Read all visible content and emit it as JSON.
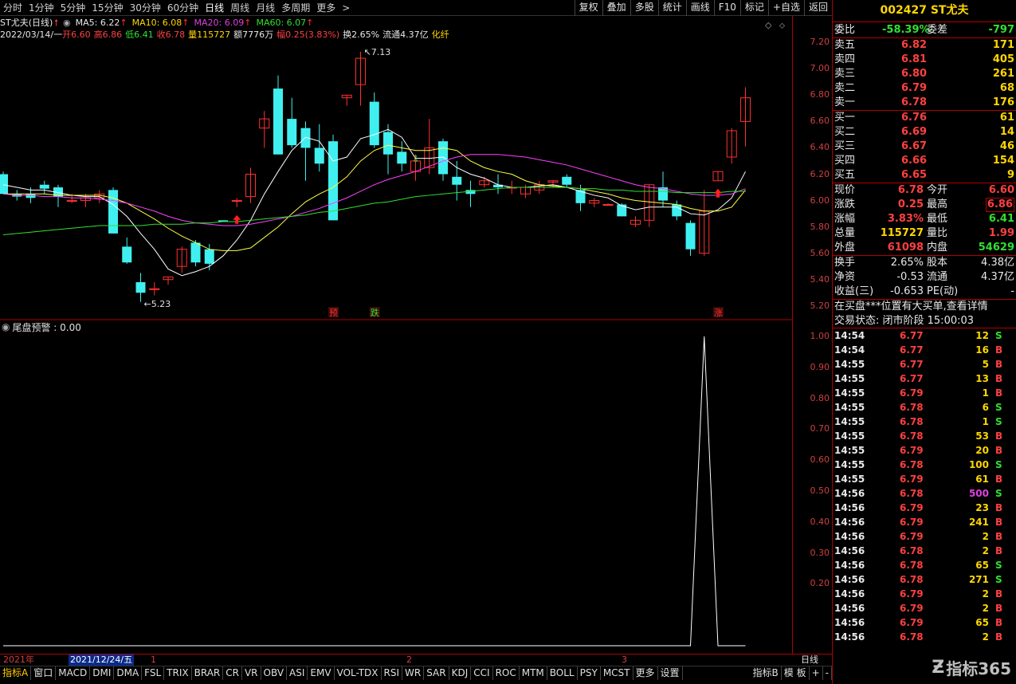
{
  "period_tabs": [
    "分时",
    "1分钟",
    "5分钟",
    "15分钟",
    "30分钟",
    "60分钟",
    "日线",
    "周线",
    "月线",
    "多周期",
    "更多"
  ],
  "active_period": "日线",
  "tool_buttons": [
    "复权",
    "叠加",
    "多股",
    "统计",
    "画线",
    "F10",
    "标记",
    "+自选",
    "返回"
  ],
  "legend": {
    "stock": "ST尤夫(日线)",
    "ma5": "MA5: 6.22",
    "ma10": "MA10: 6.08",
    "ma20": "MA20: 6.09",
    "ma60": "MA60: 6.07"
  },
  "ohlc": {
    "date": "2022/03/14/一",
    "open": "开6.60",
    "high": "高6.86",
    "low": "低6.41",
    "close": "收6.78",
    "vol": "量115727",
    "amount": "额7776万",
    "range": "幅0.25(3.83%)",
    "turnover": "换2.65%",
    "float_cap": "流通4.37亿",
    "sector": "化纤"
  },
  "price_axis": [
    "7.20",
    "7.00",
    "6.80",
    "6.60",
    "6.40",
    "6.20",
    "6.00",
    "5.80",
    "5.60",
    "5.40",
    "5.20"
  ],
  "ind_axis": [
    "1.00",
    "0.90",
    "0.80",
    "0.70",
    "0.60",
    "0.50",
    "0.40",
    "0.30",
    "0.20"
  ],
  "annotations": {
    "high": "7.13",
    "low": "5.23",
    "yu": "预",
    "die": "跌",
    "zhang": "涨"
  },
  "sub_title": "尾盘预警 : 0.00",
  "datebar": {
    "y2021": "2021年",
    "cursor": "2021/12/24/五",
    "m1": "1",
    "m2": "2",
    "m3": "3",
    "right": "日线"
  },
  "indicator_tabs": [
    "指标A",
    "窗口",
    "MACD",
    "DMI",
    "DMA",
    "FSL",
    "TRIX",
    "BRAR",
    "CR",
    "VR",
    "OBV",
    "ASI",
    "EMV",
    "VOL-TDX",
    "RSI",
    "WR",
    "SAR",
    "KDJ",
    "CCI",
    "ROC",
    "MTM",
    "BOLL",
    "PSY",
    "MCST",
    "更多",
    "设置"
  ],
  "indicator_right": [
    "指标B",
    "模 板",
    "+",
    "-"
  ],
  "quote": {
    "title": "002427 ST尤夫",
    "weibi_label": "委比",
    "weibi": "-58.39%",
    "weicha_label": "委差",
    "weicha": "-797",
    "asks": [
      {
        "label": "卖五",
        "price": "6.82",
        "vol": "171"
      },
      {
        "label": "卖四",
        "price": "6.81",
        "vol": "405"
      },
      {
        "label": "卖三",
        "price": "6.80",
        "vol": "261"
      },
      {
        "label": "卖二",
        "price": "6.79",
        "vol": "68"
      },
      {
        "label": "卖一",
        "price": "6.78",
        "vol": "176"
      }
    ],
    "bids": [
      {
        "label": "买一",
        "price": "6.76",
        "vol": "61"
      },
      {
        "label": "买二",
        "price": "6.69",
        "vol": "14"
      },
      {
        "label": "买三",
        "price": "6.67",
        "vol": "46"
      },
      {
        "label": "买四",
        "price": "6.66",
        "vol": "154"
      },
      {
        "label": "买五",
        "price": "6.65",
        "vol": "9"
      }
    ],
    "stats": [
      {
        "l1": "现价",
        "v1": "6.78",
        "l2": "今开",
        "v2": "6.60"
      },
      {
        "l1": "涨跌",
        "v1": "0.25",
        "l2": "最高",
        "v2": "6.86"
      },
      {
        "l1": "涨幅",
        "v1": "3.83%",
        "l2": "最低",
        "v2": "6.41"
      },
      {
        "l1": "总量",
        "v1": "115727",
        "l2": "量比",
        "v2": "1.99"
      },
      {
        "l1": "外盘",
        "v1": "61098",
        "l2": "内盘",
        "v2": "54629"
      }
    ],
    "stats2": [
      {
        "l1": "换手",
        "v1": "2.65%",
        "l2": "股本",
        "v2": "4.38亿"
      },
      {
        "l1": "净资",
        "v1": "-0.53",
        "l2": "流通",
        "v2": "4.37亿"
      },
      {
        "l1": "收益(三)",
        "v1": "-0.653",
        "l2": "PE(动)",
        "v2": "-"
      }
    ],
    "notice": "在买盘***位置有大买单,查看详情",
    "trade_status": "交易状态: 闭市阶段 15:00:03"
  },
  "ticks": [
    {
      "t": "14:54",
      "p": "6.77",
      "v": "12",
      "s": "S"
    },
    {
      "t": "14:54",
      "p": "6.77",
      "v": "16",
      "s": "B"
    },
    {
      "t": "14:55",
      "p": "6.77",
      "v": "5",
      "s": "B"
    },
    {
      "t": "14:55",
      "p": "6.77",
      "v": "13",
      "s": "B"
    },
    {
      "t": "14:55",
      "p": "6.79",
      "v": "1",
      "s": "B"
    },
    {
      "t": "14:55",
      "p": "6.78",
      "v": "6",
      "s": "S"
    },
    {
      "t": "14:55",
      "p": "6.78",
      "v": "1",
      "s": "S"
    },
    {
      "t": "14:55",
      "p": "6.78",
      "v": "53",
      "s": "B"
    },
    {
      "t": "14:55",
      "p": "6.79",
      "v": "20",
      "s": "B"
    },
    {
      "t": "14:55",
      "p": "6.78",
      "v": "100",
      "s": "S"
    },
    {
      "t": "14:55",
      "p": "6.79",
      "v": "61",
      "s": "B"
    },
    {
      "t": "14:56",
      "p": "6.78",
      "v": "500",
      "s": "S"
    },
    {
      "t": "14:56",
      "p": "6.79",
      "v": "23",
      "s": "B"
    },
    {
      "t": "14:56",
      "p": "6.79",
      "v": "241",
      "s": "B"
    },
    {
      "t": "14:56",
      "p": "6.79",
      "v": "2",
      "s": "B"
    },
    {
      "t": "14:56",
      "p": "6.78",
      "v": "2",
      "s": "B"
    },
    {
      "t": "14:56",
      "p": "6.78",
      "v": "65",
      "s": "S"
    },
    {
      "t": "14:56",
      "p": "6.78",
      "v": "271",
      "s": "S"
    },
    {
      "t": "14:56",
      "p": "6.79",
      "v": "2",
      "s": "B"
    },
    {
      "t": "14:56",
      "p": "6.79",
      "v": "2",
      "s": "B"
    },
    {
      "t": "14:56",
      "p": "6.79",
      "v": "65",
      "s": "B"
    },
    {
      "t": "14:56",
      "p": "6.78",
      "v": "2",
      "s": "B"
    }
  ],
  "watermark": "指标365",
  "colors": {
    "up": "#ff3030",
    "down": "#40f0f0",
    "ma5": "#ffffff",
    "ma10": "#ffff40",
    "ma20": "#ff40ff",
    "ma60": "#30e030",
    "axis": "#b00000"
  },
  "chart_data": {
    "type": "candlestick",
    "ylim": [
      5.15,
      7.25
    ],
    "candles": [
      {
        "o": 6.2,
        "h": 6.22,
        "l": 6.05,
        "c": 6.05
      },
      {
        "o": 6.05,
        "h": 6.08,
        "l": 6.0,
        "c": 6.03
      },
      {
        "o": 6.05,
        "h": 6.1,
        "l": 5.98,
        "c": 6.02
      },
      {
        "o": 6.12,
        "h": 6.15,
        "l": 6.05,
        "c": 6.09
      },
      {
        "o": 6.1,
        "h": 6.12,
        "l": 5.95,
        "c": 6.03
      },
      {
        "o": 6.0,
        "h": 6.05,
        "l": 5.98,
        "c": 6.0
      },
      {
        "o": 6.0,
        "h": 6.05,
        "l": 5.95,
        "c": 6.02
      },
      {
        "o": 6.02,
        "h": 6.08,
        "l": 5.98,
        "c": 6.05
      },
      {
        "o": 6.08,
        "h": 6.1,
        "l": 5.75,
        "c": 5.75
      },
      {
        "o": 5.65,
        "h": 5.72,
        "l": 5.52,
        "c": 5.53
      },
      {
        "o": 5.38,
        "h": 5.45,
        "l": 5.23,
        "c": 5.3
      },
      {
        "o": 5.33,
        "h": 5.38,
        "l": 5.28,
        "c": 5.33
      },
      {
        "o": 5.4,
        "h": 5.42,
        "l": 5.36,
        "c": 5.42
      },
      {
        "o": 5.5,
        "h": 5.65,
        "l": 5.45,
        "c": 5.63
      },
      {
        "o": 5.68,
        "h": 5.7,
        "l": 5.5,
        "c": 5.53
      },
      {
        "o": 5.63,
        "h": 5.67,
        "l": 5.47,
        "c": 5.52
      },
      {
        "o": 5.85,
        "h": 5.85,
        "l": 5.84,
        "c": 5.84
      },
      {
        "o": 6.0,
        "h": 6.02,
        "l": 5.95,
        "c": 6.0
      },
      {
        "o": 6.03,
        "h": 6.25,
        "l": 5.98,
        "c": 6.2
      },
      {
        "o": 6.55,
        "h": 6.68,
        "l": 6.4,
        "c": 6.62
      },
      {
        "o": 6.85,
        "h": 6.95,
        "l": 6.35,
        "c": 6.35
      },
      {
        "o": 6.62,
        "h": 6.78,
        "l": 6.4,
        "c": 6.42
      },
      {
        "o": 6.55,
        "h": 6.6,
        "l": 6.15,
        "c": 6.4
      },
      {
        "o": 6.4,
        "h": 6.58,
        "l": 6.22,
        "c": 6.28
      },
      {
        "o": 6.45,
        "h": 6.5,
        "l": 5.85,
        "c": 5.85
      },
      {
        "o": 6.78,
        "h": 6.8,
        "l": 6.72,
        "c": 6.8
      },
      {
        "o": 6.88,
        "h": 7.13,
        "l": 6.72,
        "c": 7.08
      },
      {
        "o": 6.75,
        "h": 6.82,
        "l": 6.4,
        "c": 6.42
      },
      {
        "o": 6.52,
        "h": 6.58,
        "l": 6.2,
        "c": 6.35
      },
      {
        "o": 6.37,
        "h": 6.45,
        "l": 6.22,
        "c": 6.28
      },
      {
        "o": 6.22,
        "h": 6.35,
        "l": 6.15,
        "c": 6.3
      },
      {
        "o": 6.25,
        "h": 6.62,
        "l": 6.2,
        "c": 6.4
      },
      {
        "o": 6.45,
        "h": 6.47,
        "l": 6.15,
        "c": 6.2
      },
      {
        "o": 6.18,
        "h": 6.3,
        "l": 6.0,
        "c": 6.12
      },
      {
        "o": 6.08,
        "h": 6.15,
        "l": 5.95,
        "c": 6.05
      },
      {
        "o": 6.12,
        "h": 6.18,
        "l": 6.1,
        "c": 6.15
      },
      {
        "o": 6.12,
        "h": 6.2,
        "l": 6.05,
        "c": 6.1
      },
      {
        "o": 6.1,
        "h": 6.15,
        "l": 6.05,
        "c": 6.1
      },
      {
        "o": 6.05,
        "h": 6.12,
        "l": 6.02,
        "c": 6.1
      },
      {
        "o": 6.08,
        "h": 6.15,
        "l": 6.05,
        "c": 6.12
      },
      {
        "o": 6.14,
        "h": 6.15,
        "l": 6.1,
        "c": 6.15
      },
      {
        "o": 6.18,
        "h": 6.2,
        "l": 6.1,
        "c": 6.12
      },
      {
        "o": 6.08,
        "h": 6.12,
        "l": 5.92,
        "c": 5.98
      },
      {
        "o": 5.98,
        "h": 6.02,
        "l": 5.95,
        "c": 6.0
      },
      {
        "o": 5.97,
        "h": 5.98,
        "l": 5.96,
        "c": 5.97
      },
      {
        "o": 5.97,
        "h": 5.98,
        "l": 5.88,
        "c": 5.88
      },
      {
        "o": 5.82,
        "h": 5.88,
        "l": 5.8,
        "c": 5.85
      },
      {
        "o": 5.85,
        "h": 6.12,
        "l": 5.8,
        "c": 6.12
      },
      {
        "o": 6.1,
        "h": 6.22,
        "l": 5.95,
        "c": 6.0
      },
      {
        "o": 5.97,
        "h": 6.0,
        "l": 5.85,
        "c": 5.88
      },
      {
        "o": 5.83,
        "h": 5.85,
        "l": 5.58,
        "c": 5.63
      },
      {
        "o": 5.6,
        "h": 6.08,
        "l": 5.58,
        "c": 5.92
      },
      {
        "o": 6.15,
        "h": 6.22,
        "l": 6.15,
        "c": 6.22
      },
      {
        "o": 6.33,
        "h": 6.55,
        "l": 6.28,
        "c": 6.53
      },
      {
        "o": 6.6,
        "h": 6.86,
        "l": 6.41,
        "c": 6.78
      }
    ],
    "ma5": [
      6.12,
      6.1,
      6.08,
      6.08,
      6.06,
      6.04,
      6.03,
      6.03,
      5.97,
      5.88,
      5.75,
      5.63,
      5.48,
      5.43,
      5.46,
      5.5,
      5.58,
      5.7,
      5.85,
      6.05,
      6.22,
      6.38,
      6.48,
      6.45,
      6.3,
      6.33,
      6.47,
      6.5,
      6.54,
      6.48,
      6.32,
      6.32,
      6.33,
      6.25,
      6.2,
      6.17,
      6.12,
      6.1,
      6.1,
      6.11,
      6.12,
      6.1,
      6.07,
      6.04,
      6.02,
      5.96,
      5.93,
      5.95,
      5.95,
      5.95,
      5.9,
      5.89,
      5.93,
      6.02,
      6.22
    ],
    "ma10": [
      6.05,
      6.05,
      6.05,
      6.05,
      6.04,
      6.04,
      6.04,
      6.04,
      6.02,
      5.98,
      5.92,
      5.86,
      5.79,
      5.73,
      5.68,
      5.63,
      5.62,
      5.62,
      5.64,
      5.72,
      5.8,
      5.9,
      5.99,
      6.05,
      6.1,
      6.18,
      6.3,
      6.38,
      6.42,
      6.4,
      6.38,
      6.38,
      6.4,
      6.38,
      6.3,
      6.25,
      6.22,
      6.2,
      6.15,
      6.12,
      6.11,
      6.1,
      6.09,
      6.07,
      6.05,
      6.02,
      6.0,
      5.99,
      5.98,
      5.97,
      5.94,
      5.92,
      5.92,
      5.95,
      6.08
    ],
    "ma20": [
      6.05,
      6.04,
      6.04,
      6.03,
      6.03,
      6.02,
      6.02,
      6.01,
      6.0,
      5.98,
      5.95,
      5.92,
      5.88,
      5.85,
      5.83,
      5.82,
      5.81,
      5.81,
      5.82,
      5.84,
      5.86,
      5.88,
      5.91,
      5.94,
      5.98,
      6.02,
      6.07,
      6.12,
      6.16,
      6.19,
      6.22,
      6.26,
      6.3,
      6.33,
      6.35,
      6.35,
      6.35,
      6.34,
      6.33,
      6.31,
      6.29,
      6.27,
      6.24,
      6.21,
      6.18,
      6.15,
      6.12,
      6.1,
      6.09,
      6.07,
      6.05,
      6.04,
      6.04,
      6.05,
      6.09
    ],
    "ma60": [
      5.74,
      5.75,
      5.76,
      5.77,
      5.78,
      5.79,
      5.8,
      5.81,
      5.81,
      5.81,
      5.81,
      5.82,
      5.82,
      5.82,
      5.83,
      5.83,
      5.84,
      5.84,
      5.85,
      5.86,
      5.87,
      5.88,
      5.89,
      5.91,
      5.92,
      5.94,
      5.96,
      5.98,
      5.99,
      6.01,
      6.03,
      6.04,
      6.05,
      6.06,
      6.07,
      6.08,
      6.09,
      6.1,
      6.1,
      6.1,
      6.1,
      6.1,
      6.09,
      6.09,
      6.08,
      6.08,
      6.07,
      6.07,
      6.07,
      6.06,
      6.06,
      6.06,
      6.06,
      6.07,
      6.07
    ],
    "indicator": {
      "name": "尾盘预警",
      "ylim": [
        0,
        1.0
      ],
      "spike_index": 51,
      "spike_value": 1.0
    }
  }
}
